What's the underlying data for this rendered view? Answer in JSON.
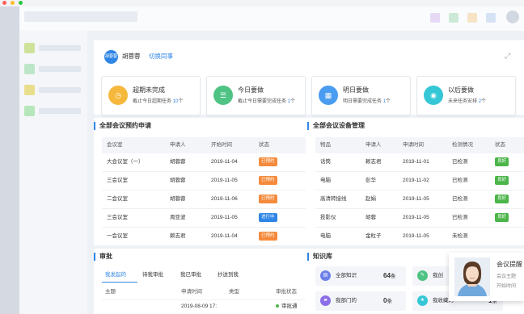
{
  "window": {
    "dots": [
      "#ff5f57",
      "#ffbd2e",
      "#28c840"
    ]
  },
  "sidebar": {
    "nav_colors": [
      "#cfe29a",
      "#bde6c9",
      "#e9de8c",
      "#b5e7bb"
    ]
  },
  "topbar": {
    "square_colors": [
      "#e5d9f5",
      "#cce9d8",
      "#f6e4c4",
      "#d6e3f5"
    ]
  },
  "user": {
    "avatar_text": "胡蓉蓉",
    "name": "胡蓉蓉",
    "switch_label": "切换同事"
  },
  "cards": [
    {
      "title": "超期未完成",
      "sub_prefix": "截止今日超期任务",
      "count": "10",
      "unit": "个",
      "icon": "clock-icon",
      "color": "#f5b83d",
      "bg": "#fff"
    },
    {
      "title": "今日要做",
      "sub_prefix": "截止今日需要完成任务",
      "count": "1",
      "unit": "个",
      "icon": "list-icon",
      "color": "#4fc383",
      "bg": "#fff"
    },
    {
      "title": "明日要做",
      "sub_prefix": "明日需要完成任务",
      "count": "1",
      "unit": "个",
      "icon": "calendar-icon",
      "color": "#4a9cf0",
      "bg": "#fff"
    },
    {
      "title": "以后要做",
      "sub_prefix": "未来任务安排",
      "count": "2",
      "unit": "个",
      "icon": "target-icon",
      "color": "#36c7d7",
      "bg": "#fff"
    }
  ],
  "meetings": {
    "title": "全部会议预约申请",
    "headers": [
      "会议室",
      "申请人",
      "开始时间",
      "状态"
    ],
    "rows": [
      {
        "room": "大会议室（一）",
        "applicant": "胡蓉蓉",
        "date": "2019-11-04",
        "status": "已预约",
        "status_color": "#f48a3b"
      },
      {
        "room": "三会议室",
        "applicant": "胡蓉蓉",
        "date": "2019-11-05",
        "status": "已预约",
        "status_color": "#f48a3b"
      },
      {
        "room": "二会议室",
        "applicant": "胡蓉蓉",
        "date": "2019-11-06",
        "status": "已预约",
        "status_color": "#f48a3b"
      },
      {
        "room": "三会议室",
        "applicant": "周亚波",
        "date": "2019-11-05",
        "status": "进行中",
        "status_color": "#2f86e6"
      },
      {
        "room": "一会议室",
        "applicant": "赖志君",
        "date": "2019-11-04",
        "status": "已预约",
        "status_color": "#f48a3b"
      }
    ]
  },
  "equipment": {
    "title": "全部会议设备管理",
    "headers": [
      "物品",
      "申请人",
      "申请时间",
      "检测情况",
      "状态"
    ],
    "rows": [
      {
        "item": "话筒",
        "applicant": "赖志君",
        "date": "2019-11-01",
        "check": "已检测",
        "status": "良好"
      },
      {
        "item": "电脑",
        "applicant": "彭华",
        "date": "2019-11-02",
        "check": "已检测",
        "status": "良好"
      },
      {
        "item": "高清转接线",
        "applicant": "赵娟",
        "date": "2019-11-05",
        "check": "已检测",
        "status": "良好"
      },
      {
        "item": "投影仪",
        "applicant": "胡蓉",
        "date": "2019-11-05",
        "check": "已检测",
        "status": "良好"
      },
      {
        "item": "电脑",
        "applicant": "金粒子",
        "date": "2019-11-05",
        "check": "未检测",
        "status": ""
      }
    ],
    "good_color": "#4cb54a"
  },
  "approval": {
    "title": "审批",
    "tabs": [
      "我发起的",
      "待我审批",
      "我已审批",
      "抄送到我"
    ],
    "headers": [
      "主题",
      "申请时间",
      "类型",
      "审批状态"
    ],
    "row": {
      "date": "2019-08-09 17:",
      "status": "审批通"
    }
  },
  "knowledge": {
    "title": "知识库",
    "items": [
      {
        "label": "全部知识",
        "count": "64",
        "unit": "条",
        "color": "#6d7fe8",
        "icon": "book-icon"
      },
      {
        "label": "我创",
        "count": "",
        "unit": "",
        "color": "#4fc383",
        "icon": "doc-icon"
      },
      {
        "label": "我部门的",
        "count": "0",
        "unit": "条",
        "color": "#8b6ee8",
        "icon": "folder-icon"
      },
      {
        "label": "我收藏的",
        "count": "1",
        "unit": "条",
        "color": "#36c7d7",
        "icon": "star-icon"
      }
    ]
  },
  "popup": {
    "title": "会议提醒",
    "line1": "会议主题",
    "line2": "开始时间"
  }
}
